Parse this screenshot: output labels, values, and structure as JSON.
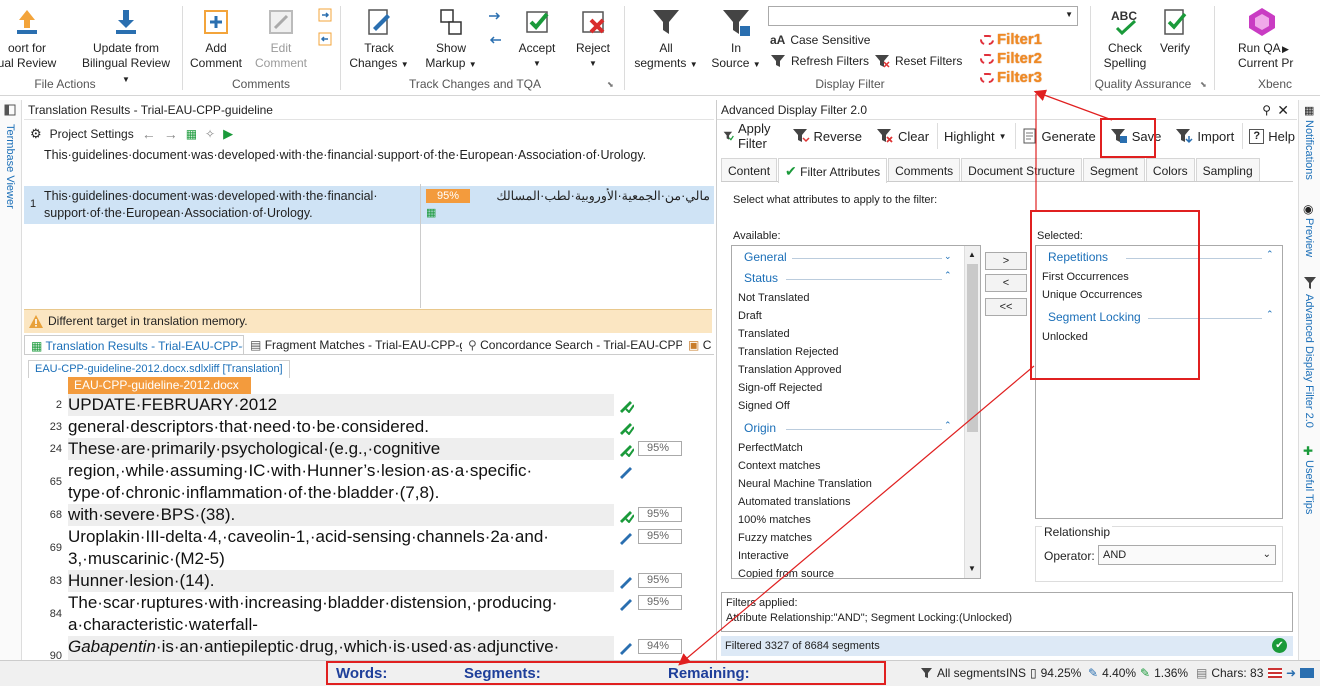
{
  "ribbon": {
    "file_actions": {
      "btn1": [
        "oort for",
        "ual Review"
      ],
      "btn2": [
        "Update from",
        "Bilingual Review"
      ],
      "label": "File Actions"
    },
    "comments": {
      "add": [
        "Add",
        "Comment"
      ],
      "edit": [
        "Edit",
        "Comment"
      ],
      "label": "Comments"
    },
    "track": {
      "track_changes": [
        "Track",
        "Changes"
      ],
      "show_markup": [
        "Show",
        "Markup"
      ],
      "accept": "Accept",
      "reject": "Reject",
      "label": "Track Changes and TQA"
    },
    "display_filter": {
      "all_segments": [
        "All",
        "segments"
      ],
      "in_source": [
        "In",
        "Source"
      ],
      "case_sensitive": "Case Sensitive",
      "refresh_filters": "Refresh Filters",
      "reset_filters": "Reset Filters",
      "filters": [
        "Filter1",
        "Filter2",
        "Filter3"
      ],
      "label": "Display Filter"
    },
    "qa": {
      "check_spelling": [
        "Check",
        "Spelling"
      ],
      "verify": "Verify",
      "label": "Quality Assurance"
    },
    "run_qa": {
      "label": [
        "Run QA",
        "Current Pr"
      ],
      "group": "Xbenc"
    }
  },
  "left_strip": {
    "termbase": "Termbase Viewer"
  },
  "results": {
    "title": "Translation Results - Trial-EAU-CPP-guideline",
    "project_settings": "Project Settings",
    "source_preview": "This·guidelines·document·was·developed·with·the·financial·support·of·the·European·Association·of·Urology.",
    "row_num": "1",
    "row_src": "This·guidelines·document·was·developed·with·the·financial· support·of·the·European·Association·of·Urology.",
    "match_pct": "95%",
    "row_tgt": "مالي·من·الجمعية·الأوروبية·لطب·المسالك",
    "warning": "Different target in translation memory."
  },
  "bottom_tabs": [
    "Translation Results - Trial-EAU-CPP-guid...",
    "Fragment Matches - Trial-EAU-CPP-guid...",
    "Concordance Search - Trial-EAU-CPP-gui...",
    "C"
  ],
  "editor": {
    "tab": "EAU-CPP-guideline-2012.docx.sdlxliff [Translation]",
    "file": "EAU-CPP-guideline-2012.docx",
    "rows": [
      {
        "num": "2",
        "text": "UPDATE·FEBRUARY·2012",
        "pct": ""
      },
      {
        "num": "23",
        "text": "general·descriptors·that·need·to·be·considered.",
        "pct": ""
      },
      {
        "num": "24",
        "text": "These·are·primarily·psychological·(e.g.,·cognitive",
        "pct": "95%"
      },
      {
        "num": "65",
        "text": "region,·while·assuming·IC·with·Hunner’s·lesion·as·a·specific· type·of·chronic·inflammation·of·the·bladder·(7,8).",
        "pct": ""
      },
      {
        "num": "68",
        "text": "with·severe·BPS·(38).",
        "pct": "95%"
      },
      {
        "num": "69",
        "text": "Uroplakin·III-delta·4,·caveolin-1,·acid-sensing·channels·2a·and· 3,·muscarinic·(M2-5)",
        "pct": "95%"
      },
      {
        "num": "83",
        "text": "Hunner·lesion·(14).",
        "pct": "95%"
      },
      {
        "num": "84",
        "text": "The·scar·ruptures·with·increasing·bladder·distension,·producing· a·characteristic·waterfall-",
        "pct": "95%"
      },
      {
        "num": "90",
        "text_italic": "Gabapentin",
        "text": "·is·an·antiepileptic·drug,·which·is·used·as·adjunctive·",
        "pct": "94%"
      }
    ]
  },
  "adf": {
    "title": "Advanced Display Filter 2.0",
    "tools": [
      "Apply Filter",
      "Reverse",
      "Clear",
      "Highlight",
      "Generate",
      "Save",
      "Import",
      "Help"
    ],
    "tabs": [
      "Content",
      "Filter Attributes",
      "Comments",
      "Document Structure",
      "Segment",
      "Colors",
      "Sampling"
    ],
    "instruction": "Select what attributes to apply to the filter:",
    "available_label": "Available:",
    "selected_label": "Selected:",
    "available": {
      "general": "General",
      "status": "Status",
      "status_items": [
        "Not Translated",
        "Draft",
        "Translated",
        "Translation Rejected",
        "Translation Approved",
        "Sign-off Rejected",
        "Signed Off"
      ],
      "origin": "Origin",
      "origin_items": [
        "PerfectMatch",
        "Context matches",
        "Neural Machine Translation",
        "Automated translations",
        "100% matches",
        "Fuzzy matches",
        "Interactive",
        "Copied from source"
      ]
    },
    "selected": {
      "repetitions": "Repetitions",
      "rep_items": [
        "First Occurrences",
        "Unique Occurrences"
      ],
      "locking": "Segment Locking",
      "lock_items": [
        "Unlocked"
      ]
    },
    "move_buttons": [
      ">",
      "<",
      "<<"
    ],
    "relationship": "Relationship",
    "operator_label": "Operator:",
    "operator_value": "AND",
    "filters_applied_label": "Filters applied:",
    "filters_applied_value": "Attribute Relationship:\"AND\"; Segment Locking:(Unlocked)",
    "filtered": "Filtered 3327 of 8684 segments"
  },
  "right_strip": [
    "Notifications",
    "Preview",
    "Advanced Display Filter 2.0",
    "Useful Tips"
  ],
  "status": {
    "words": "Words:",
    "segments": "Segments:",
    "remaining": "Remaining:",
    "all_segments": "All segments",
    "ins": "INS",
    "p1": "94.25%",
    "p2": "4.40%",
    "p3": "1.36%",
    "chars": "Chars: 83"
  }
}
